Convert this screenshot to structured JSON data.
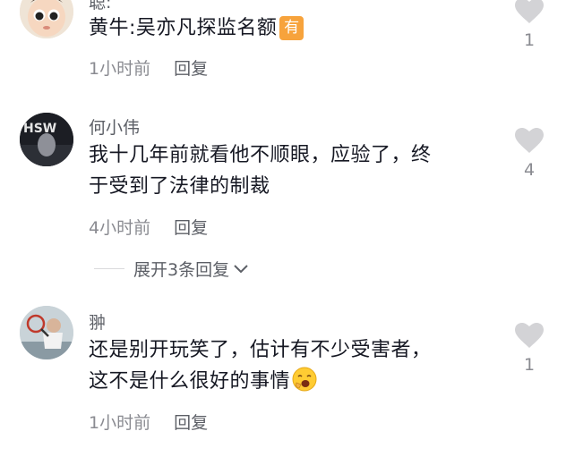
{
  "comments": [
    {
      "author": "聪:",
      "text": "黄牛:吴亦凡探监名额",
      "badge": "有",
      "time": "1小时前",
      "reply": "回复",
      "likes": "1"
    },
    {
      "author": "何小伟",
      "avatar_text": "HSW",
      "text_line1": "我十几年前就看他不顺眼，应验了，终",
      "text_line2": "于受到了法律的制裁",
      "time": "4小时前",
      "reply": "回复",
      "likes": "4"
    },
    {
      "author": "翀",
      "text_line1": "还是别开玩笑了，估计有不少受害者，",
      "text_line2": "这不是什么很好的事情",
      "time": "1小时前",
      "reply": "回复",
      "likes": "1"
    }
  ],
  "expand_replies": "展开3条回复",
  "colors": {
    "badge": "#f7a33c",
    "heart": "#d3d3d6",
    "secondary": "#8a8b91"
  }
}
